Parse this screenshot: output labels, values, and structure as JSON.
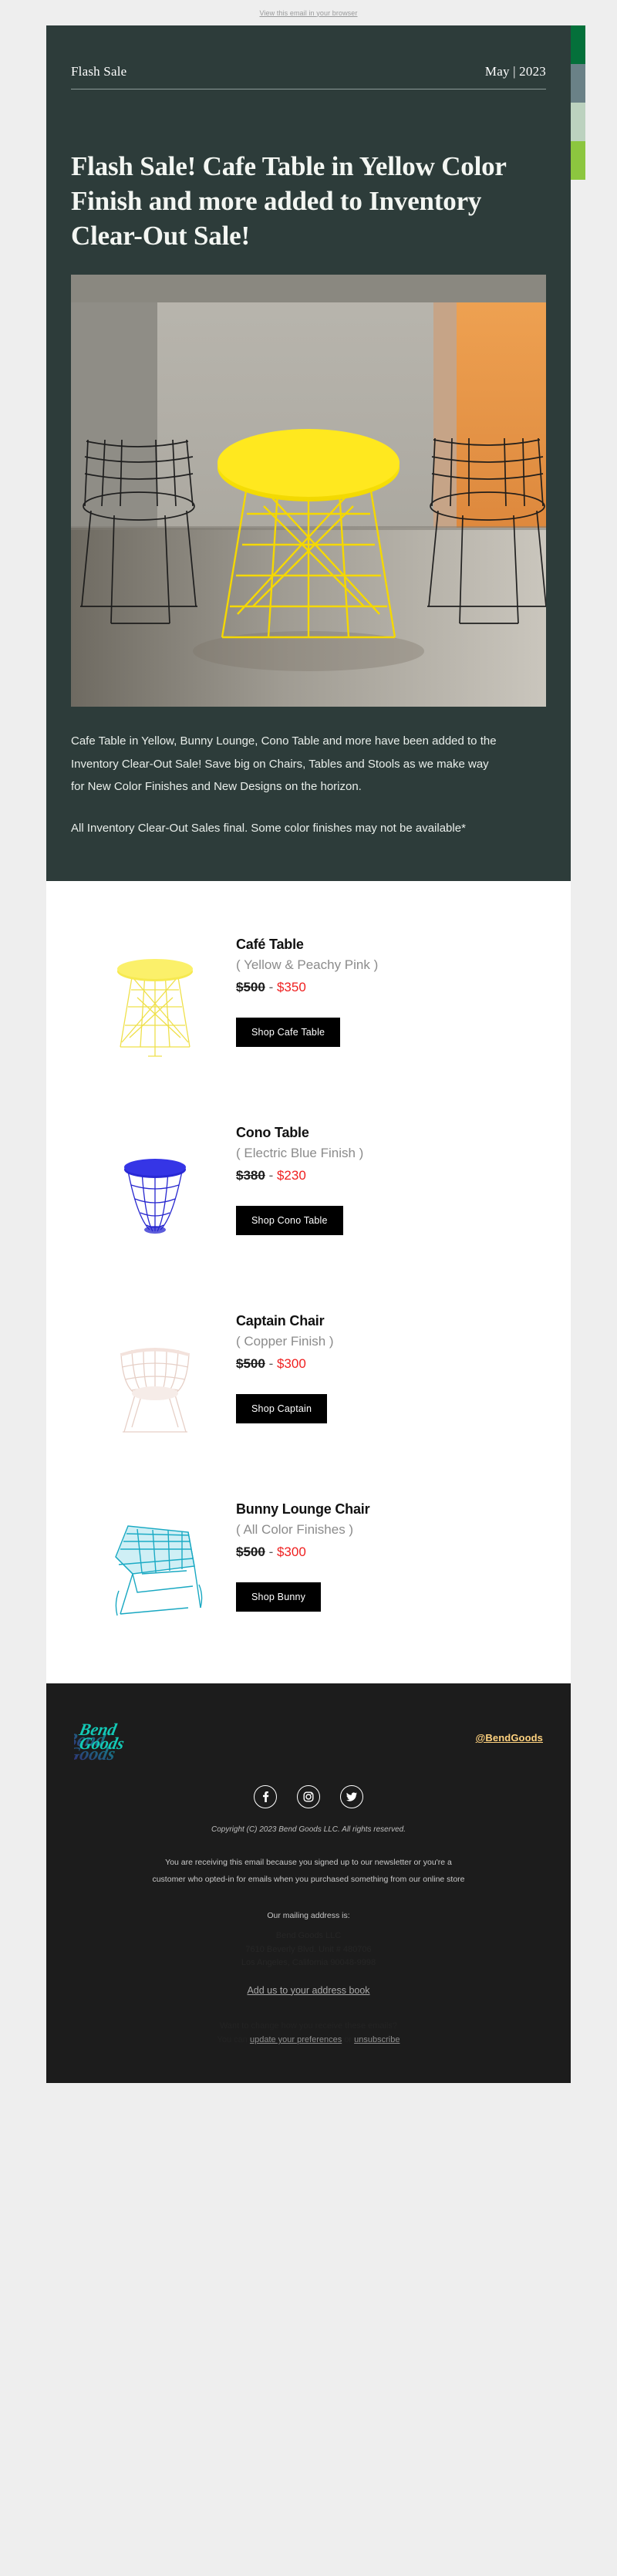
{
  "preheader": {
    "link": "View this email in your browser"
  },
  "hero": {
    "brand": "Flash Sale",
    "date": "May | 2023",
    "headline": "Flash Sale! Cafe Table in Yellow Color Finish and more added to Inventory Clear-Out Sale!",
    "paragraph1": "Cafe Table in Yellow, Bunny Lounge, Cono Table and more have been added to the Inventory Clear-Out Sale! Save big on Chairs, Tables and Stools as we make way for New Color Finishes and New Designs on the horizon.",
    "paragraph2": "All Inventory Clear-Out Sales final. Some color finishes may not be available*",
    "image_alt": "Yellow wire cafe table between two black wire chairs in a concrete room",
    "background": "#2d3c3a",
    "swatches": [
      "#04703a",
      "#6a8187",
      "#bcd2bf",
      "#8cc63f"
    ]
  },
  "products": [
    {
      "name": "Café Table",
      "finish": "( Yellow & Peachy Pink )",
      "price_old": "$500",
      "price_dash": "-",
      "price_new": "$350",
      "button": "Shop Cafe Table",
      "swatch": "#f2e23a",
      "image_alt": "Yellow wire cafe table"
    },
    {
      "name": "Cono Table",
      "finish": "( Electric Blue Finish )",
      "price_old": "$380",
      "price_dash": "-",
      "price_new": "$230",
      "button": "Shop Cono Table",
      "swatch": "#2222cc",
      "image_alt": "Electric blue wire cono side table"
    },
    {
      "name": "Captain Chair",
      "finish": "( Copper Finish )",
      "price_old": "$500",
      "price_dash": "-",
      "price_new": "$300",
      "button": "Shop Captain",
      "swatch": "#f0ddd6",
      "image_alt": "Copper finish captain wire chair"
    },
    {
      "name": "Bunny Lounge Chair",
      "finish": "( All Color Finishes )",
      "price_old": "$500",
      "price_dash": "-",
      "price_new": "$300",
      "button": "Shop Bunny",
      "swatch": "#16a8c0",
      "image_alt": "Teal bunny lounge wire chair"
    }
  ],
  "footer": {
    "logo_line1": "Bend",
    "logo_line2": "Goods",
    "logo_color": "#13c9b6",
    "handle": "@BendGoods",
    "handle_color": "#ffd27f",
    "social": [
      {
        "name": "facebook-icon",
        "label": "Facebook"
      },
      {
        "name": "instagram-icon",
        "label": "Instagram"
      },
      {
        "name": "twitter-icon",
        "label": "Twitter"
      }
    ],
    "copyright": "Copyright (C) 2023 Bend Goods LLC. All rights reserved.",
    "optin_line1": "You are receiving this email because you signed up to our newsletter or you're a",
    "optin_line2": "customer who opted-in for emails when you purchased something from our online store",
    "mailing_label": "Our mailing address is:",
    "address_line1": "Bend Goods LLC",
    "address_line2": "7610 Beverly Blvd. Unit # 480706",
    "address_line3": "Los Angeles, California 90048-9998",
    "address_book_link": "Add us to your address book",
    "prefs_line1": "Want to change how you receive these emails?",
    "prefs_prefix": "You can ",
    "prefs_link1": "update your preferences",
    "prefs_mid": " or ",
    "prefs_link2": "unsubscribe"
  }
}
